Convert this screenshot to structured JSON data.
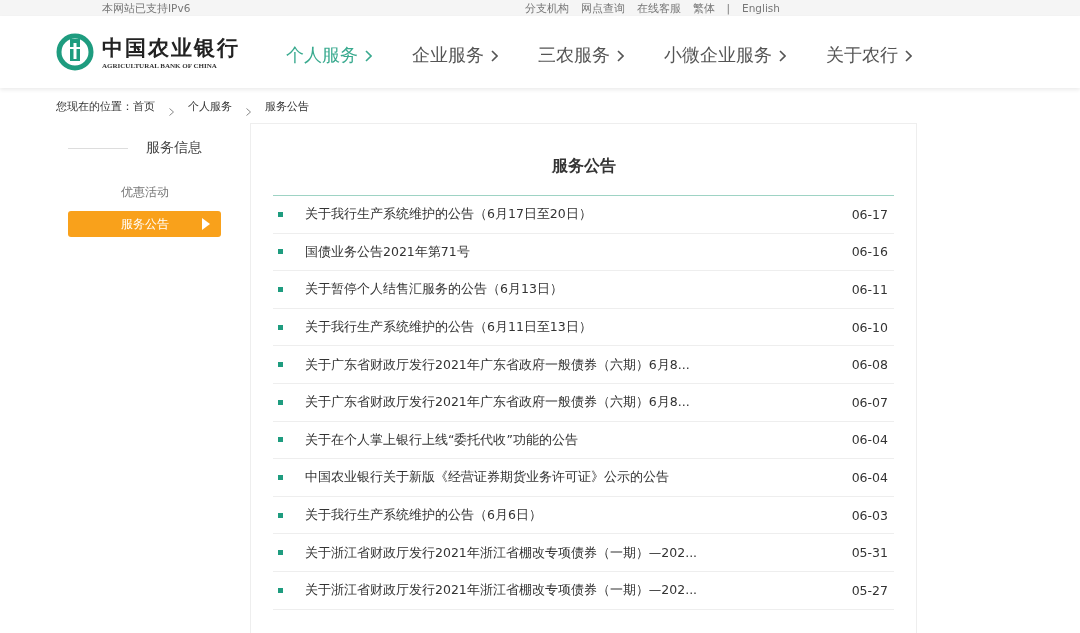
{
  "top_bar": {
    "notice": "本网站已支持IPv6",
    "links": [
      "分支机构",
      "网点查询",
      "在线客服",
      "繁体",
      "|",
      "English"
    ]
  },
  "logo": {
    "name": "中国农业银行",
    "english": "AGRICULTURAL BANK OF CHINA"
  },
  "nav": [
    {
      "label": "个人服务",
      "selected": true
    },
    {
      "label": "企业服务",
      "selected": false
    },
    {
      "label": "三农服务",
      "selected": false
    },
    {
      "label": "小微企业服务",
      "selected": false
    },
    {
      "label": "关于农行",
      "selected": false
    }
  ],
  "breadcrumb": {
    "prefix": "您现在的位置：",
    "items": [
      "首页",
      "个人服务",
      "服务公告"
    ]
  },
  "sidebar": {
    "title": "服务信息",
    "items": [
      {
        "label": "优惠活动",
        "selected": false
      },
      {
        "label": "服务公告",
        "selected": true
      }
    ]
  },
  "content": {
    "title": "服务公告",
    "rows": [
      {
        "title": "关于我行生产系统维护的公告（6月17日至20日）",
        "date": "06-17"
      },
      {
        "title": "国债业务公告2021年第71号",
        "date": "06-16"
      },
      {
        "title": "关于暂停个人结售汇服务的公告（6月13日）",
        "date": "06-11"
      },
      {
        "title": "关于我行生产系统维护的公告（6月11日至13日）",
        "date": "06-10"
      },
      {
        "title": "关于广东省财政厅发行2021年广东省政府一般债券（六期）6月8...",
        "date": "06-08"
      },
      {
        "title": "关于广东省财政厅发行2021年广东省政府一般债券（六期）6月8...",
        "date": "06-07"
      },
      {
        "title": "关于在个人掌上银行上线“委托代收”功能的公告",
        "date": "06-04"
      },
      {
        "title": "中国农业银行关于新版《经营证券期货业务许可证》公示的公告",
        "date": "06-04"
      },
      {
        "title": "关于我行生产系统维护的公告（6月6日）",
        "date": "06-03"
      },
      {
        "title": "关于浙江省财政厅发行2021年浙江省棚改专项债券（一期）—202...",
        "date": "05-31"
      },
      {
        "title": "关于浙江省财政厅发行2021年浙江省棚改专项债券（一期）—202...",
        "date": "05-27"
      }
    ]
  }
}
